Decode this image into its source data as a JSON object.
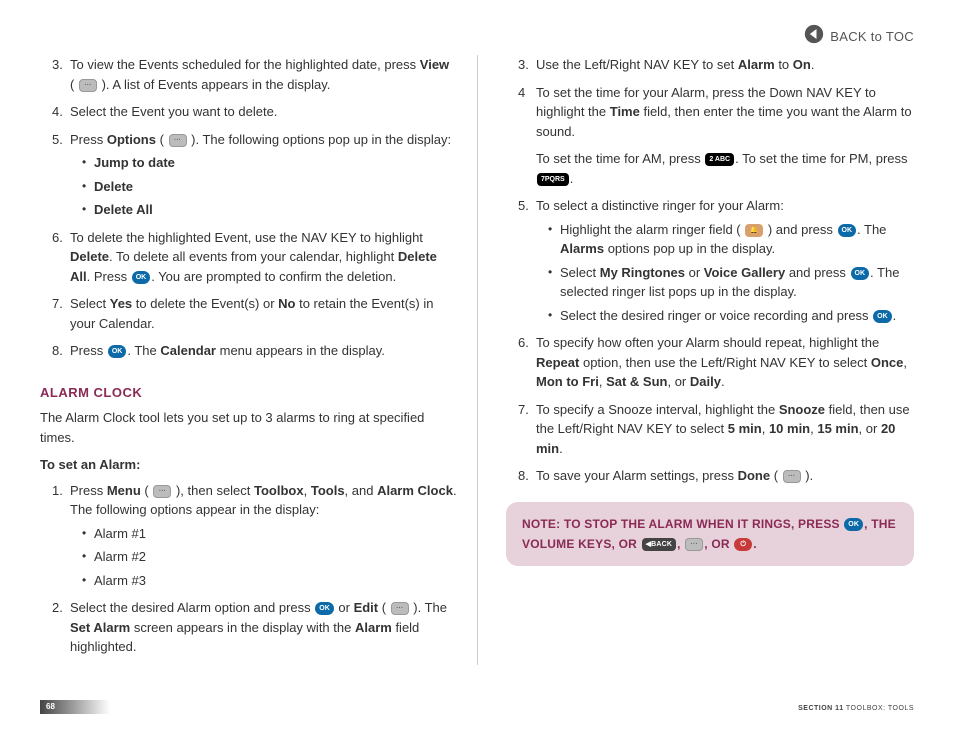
{
  "header": {
    "toc_label": "BACK to TOC"
  },
  "left": {
    "steps_a": [
      {
        "n": "3.",
        "frags": [
          "To view the Events scheduled for the highlighted date, press ",
          {
            "b": "View"
          },
          " ( ",
          {
            "icon": "grey",
            "t": "···"
          },
          " ). A list of Events appears in the display."
        ]
      },
      {
        "n": "4.",
        "frags": [
          "Select the Event you want to delete."
        ]
      },
      {
        "n": "5.",
        "frags": [
          "Press ",
          {
            "b": "Options"
          },
          " ( ",
          {
            "icon": "grey",
            "t": "···"
          },
          " ). The following options pop up in the display:"
        ],
        "bullets": [
          [
            {
              "b": "Jump to date"
            }
          ],
          [
            {
              "b": "Delete"
            }
          ],
          [
            {
              "b": "Delete All"
            }
          ]
        ]
      },
      {
        "n": "6.",
        "frags": [
          "To delete the highlighted Event, use the NAV KEY to highlight ",
          {
            "b": "Delete"
          },
          ". To delete all events from your calendar, highlight ",
          {
            "b": "Delete All"
          },
          ". Press ",
          {
            "icon": "ok",
            "t": "OK"
          },
          ". You are prompted to confirm the deletion."
        ]
      },
      {
        "n": "7.",
        "frags": [
          "Select ",
          {
            "b": "Yes"
          },
          " to delete the Event(s) or ",
          {
            "b": "No"
          },
          " to retain the Event(s) in your Calendar."
        ]
      },
      {
        "n": "8.",
        "frags": [
          "Press ",
          {
            "icon": "ok",
            "t": "OK"
          },
          ". The ",
          {
            "b": "Calendar"
          },
          " menu appears in the display."
        ]
      }
    ],
    "section_title": "ALARM CLOCK",
    "section_intro": "The Alarm Clock tool lets you set up to 3 alarms to ring at specified times.",
    "subhead": "To set an Alarm:",
    "steps_b": [
      {
        "n": "1.",
        "frags": [
          "Press ",
          {
            "b": "Menu"
          },
          " ( ",
          {
            "icon": "grey",
            "t": "···"
          },
          " ), then select ",
          {
            "b": "Toolbox"
          },
          ", ",
          {
            "b": "Tools"
          },
          ", and ",
          {
            "b": "Alarm Clock"
          },
          ". The following options appear in the display:"
        ],
        "bullets": [
          [
            "Alarm #1"
          ],
          [
            "Alarm #2"
          ],
          [
            "Alarm #3"
          ]
        ]
      },
      {
        "n": "2.",
        "frags": [
          "Select the desired Alarm option and press ",
          {
            "icon": "ok",
            "t": "OK"
          },
          " or ",
          {
            "b": "Edit"
          },
          " ( ",
          {
            "icon": "grey",
            "t": "···"
          },
          " ).  The ",
          {
            "b": "Set Alarm"
          },
          " screen appears in the display with the ",
          {
            "b": "Alarm"
          },
          " field highlighted."
        ]
      }
    ]
  },
  "right": {
    "steps": [
      {
        "n": "3.",
        "frags": [
          "Use the Left/Right NAV KEY to set ",
          {
            "b": "Alarm"
          },
          " to ",
          {
            "b": "On"
          },
          "."
        ]
      },
      {
        "n": "4",
        "noperiod": true,
        "frags": [
          "To set the time for your Alarm, press the Down NAV KEY to highlight the ",
          {
            "b": "Time"
          },
          " field, then enter the time you want the Alarm to sound."
        ],
        "after": [
          "To set the time for AM, press ",
          {
            "icon": "black",
            "t": "2 ABC"
          },
          ". To set the time for PM, press ",
          {
            "icon": "black",
            "t": "7PQRS"
          },
          "."
        ]
      },
      {
        "n": "5.",
        "frags": [
          "To select a distinctive ringer for your Alarm:"
        ],
        "bullets": [
          [
            "Highlight the alarm ringer field ( ",
            {
              "icon": "orange",
              "t": "🔔"
            },
            " ) and press ",
            {
              "icon": "ok",
              "t": "OK"
            },
            ". The ",
            {
              "b": "Alarms"
            },
            " options pop up in the display."
          ],
          [
            "Select ",
            {
              "b": "My Ringtones"
            },
            " or ",
            {
              "b": "Voice Gallery"
            },
            " and press ",
            {
              "icon": "ok",
              "t": "OK"
            },
            ". The selected ringer list pops up in the display."
          ],
          [
            "Select the desired ringer or voice recording and press ",
            {
              "icon": "ok",
              "t": "OK"
            },
            "."
          ]
        ]
      },
      {
        "n": "6.",
        "frags": [
          "To specify how often your Alarm should repeat, highlight the ",
          {
            "b": "Repeat"
          },
          " option, then use the Left/Right NAV KEY to select ",
          {
            "b": "Once"
          },
          ", ",
          {
            "b": "Mon to Fri"
          },
          ", ",
          {
            "b": "Sat & Sun"
          },
          ", or ",
          {
            "b": "Daily"
          },
          "."
        ]
      },
      {
        "n": "7.",
        "frags": [
          "To specify a Snooze interval, highlight the ",
          {
            "b": "Snooze"
          },
          " field, then use the Left/Right NAV KEY to select ",
          {
            "b": "5 min"
          },
          ", ",
          {
            "b": "10 min"
          },
          ", ",
          {
            "b": "15 min"
          },
          ", or ",
          {
            "b": "20 min"
          },
          "."
        ]
      },
      {
        "n": "8.",
        "frags": [
          "To save your Alarm settings, press ",
          {
            "b": "Done"
          },
          " ( ",
          {
            "icon": "grey",
            "t": "···"
          },
          " )."
        ]
      }
    ],
    "note": {
      "label": "NOTE:",
      "frags": [
        " TO STOP THE ALARM WHEN IT RINGS, PRESS ",
        {
          "icon": "ok",
          "t": "OK"
        },
        ", THE VOLUME KEYS, OR ",
        {
          "icon": "dark",
          "t": "◀BACK"
        },
        ", ",
        {
          "icon": "grey",
          "t": "···"
        },
        ", OR ",
        {
          "icon": "red",
          "t": "⏻"
        },
        "."
      ]
    }
  },
  "footer": {
    "page": "68",
    "section_bold": "SECTION 11",
    "section_rest": " TOOLBOX: TOOLS"
  }
}
